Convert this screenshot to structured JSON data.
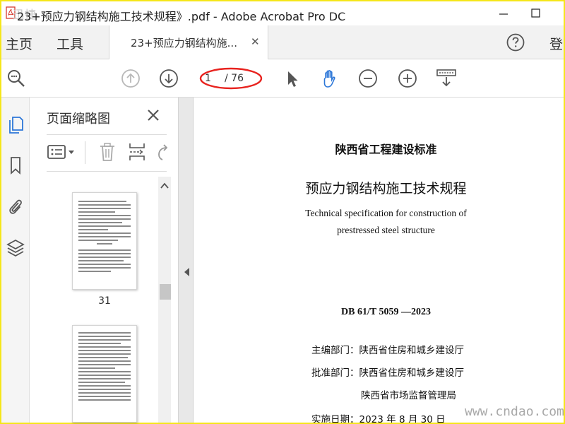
{
  "window": {
    "logo_text": "迅捷",
    "title": "23+预应力钢结构施工技术规程》.pdf - Adobe Acrobat Pro DC"
  },
  "tabs": {
    "home": "主页",
    "tools": "工具",
    "document": "23+预应力钢结构施...",
    "signin": "登"
  },
  "toolbar": {
    "current_page": "1",
    "page_total": "/ 76"
  },
  "thumbnail_panel": {
    "title": "页面缩略图",
    "thumbnails": [
      {
        "page_label": "31"
      },
      {
        "page_label": ""
      }
    ]
  },
  "document": {
    "standard_type": "陕西省工程建设标准",
    "title_cn": "预应力钢结构施工技术规程",
    "title_en_line1": "Technical specification for construction of",
    "title_en_line2": "prestressed steel structure",
    "code": "DB 61/T  5059 —2023",
    "editor": "主编部门：陕西省住房和城乡建设厅",
    "approver": "批准部门：陕西省住房和城乡建设厅",
    "approver2": "陕西省市场监督管理局",
    "effective": "实施日期：2023 年 8 月 30 日"
  },
  "watermark": "www.cndao.com",
  "colors": {
    "window_border": "#f5e61a",
    "annotation_oval": "#e8231f",
    "hand_tool": "#2d77d8",
    "icon_gray": "#555555",
    "icon_disabled": "#b8b8b8"
  },
  "icons": [
    "pdf-logo-icon",
    "minimize-icon",
    "maximize-icon",
    "close-tab-icon",
    "help-icon",
    "zoom-search-icon",
    "prev-page-icon",
    "next-page-icon",
    "select-arrow-icon",
    "hand-tool-icon",
    "zoom-out-icon",
    "zoom-in-icon",
    "scroll-mode-icon",
    "pages-icon",
    "bookmark-icon",
    "attachment-icon",
    "layers-icon",
    "close-icon",
    "thumbnail-options-icon",
    "delete-icon",
    "insert-page-icon",
    "rotate-icon",
    "chevron-up-icon",
    "collapse-left-icon"
  ]
}
